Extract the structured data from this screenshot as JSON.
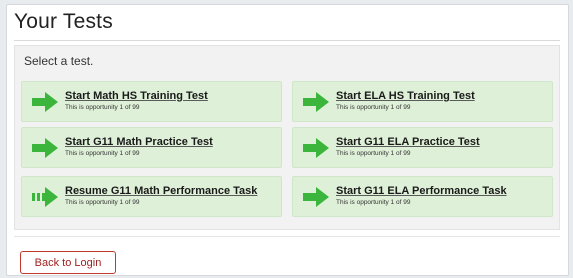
{
  "page": {
    "title": "Your Tests",
    "prompt": "Select a test."
  },
  "tests": [
    {
      "title": "Start Math HS Training Test",
      "subtitle": "This is opportunity 1 of 99",
      "icon": "start-arrow-icon"
    },
    {
      "title": "Start ELA HS Training Test",
      "subtitle": "This is opportunity 1 of 99",
      "icon": "start-arrow-icon"
    },
    {
      "title": "Start G11 Math Practice Test",
      "subtitle": "This is opportunity 1 of 99",
      "icon": "start-arrow-icon"
    },
    {
      "title": "Start G11 ELA Practice Test",
      "subtitle": "This is opportunity 1 of 99",
      "icon": "start-arrow-icon"
    },
    {
      "title": "Resume G11 Math Performance Task",
      "subtitle": "This is opportunity 1 of 99",
      "icon": "resume-arrow-icon"
    },
    {
      "title": "Start G11 ELA Performance Task",
      "subtitle": "This is opportunity 1 of 99",
      "icon": "start-arrow-icon"
    }
  ],
  "footer": {
    "back_label": "Back to Login"
  },
  "colors": {
    "card_bg": "#dff0d8",
    "arrow": "#3bb53b",
    "back_border": "#c0392b"
  }
}
